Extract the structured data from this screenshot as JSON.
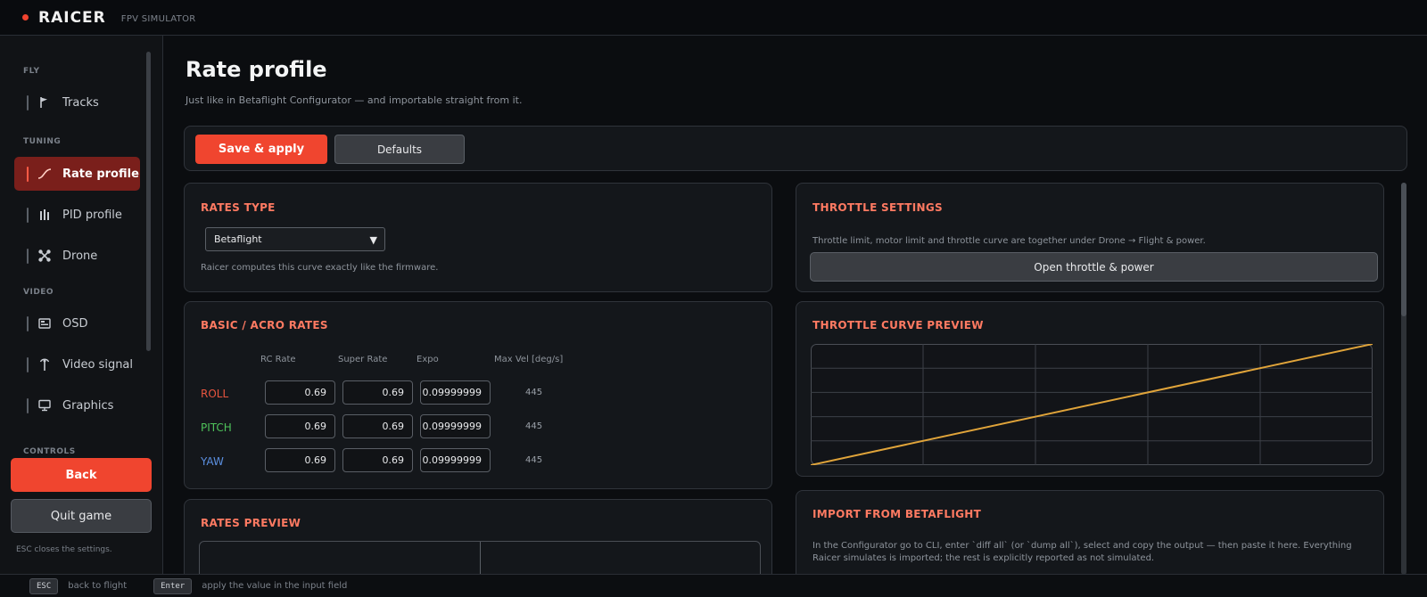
{
  "app": {
    "brand": "RAICER",
    "subtitle": "FPV SIMULATOR"
  },
  "sidebar": {
    "sections": [
      {
        "label": "FLY"
      },
      {
        "label": "TUNING"
      },
      {
        "label": "VIDEO"
      },
      {
        "label": "CONTROLS"
      }
    ],
    "items": [
      {
        "label": "Tracks",
        "icon": "flag-icon"
      },
      {
        "label": "Rate profile",
        "icon": "curve-icon",
        "active": true
      },
      {
        "label": "PID profile",
        "icon": "bars-icon"
      },
      {
        "label": "Drone",
        "icon": "drone-icon"
      },
      {
        "label": "OSD",
        "icon": "osd-icon"
      },
      {
        "label": "Video signal",
        "icon": "antenna-icon"
      },
      {
        "label": "Graphics",
        "icon": "monitor-icon"
      }
    ],
    "back_label": "Back",
    "quit_label": "Quit game",
    "esc_hint": "ESC closes the settings."
  },
  "bottom": {
    "hints": [
      {
        "key": "ESC",
        "text": "back to flight"
      },
      {
        "key": "Enter",
        "text": "apply the value in the input field"
      }
    ]
  },
  "page": {
    "title": "Rate profile",
    "subtitle": "Just like in Betaflight Configurator — and importable straight from it.",
    "save_label": "Save & apply",
    "defaults_label": "Defaults"
  },
  "rates_type": {
    "title": "RATES TYPE",
    "selected": "Betaflight",
    "note": "Raicer computes this curve exactly like the firmware."
  },
  "acro": {
    "title": "BASIC / ACRO RATES",
    "columns": [
      "RC Rate",
      "Super Rate",
      "Expo",
      "Max Vel [deg/s]"
    ],
    "rows": [
      {
        "label": "ROLL",
        "rc_rate": "0.69",
        "super_rate": "0.69",
        "expo": "0.09999999",
        "max_vel": "445",
        "color": "#e8553f"
      },
      {
        "label": "PITCH",
        "rc_rate": "0.69",
        "super_rate": "0.69",
        "expo": "0.09999999",
        "max_vel": "445",
        "color": "#4ec25a"
      },
      {
        "label": "YAW",
        "rc_rate": "0.69",
        "super_rate": "0.69",
        "expo": "0.09999999",
        "max_vel": "445",
        "color": "#5b8fe0"
      }
    ]
  },
  "rates_preview": {
    "title": "RATES PREVIEW"
  },
  "throttle": {
    "title": "THROTTLE SETTINGS",
    "note": "Throttle limit, motor limit and throttle curve are together under Drone → Flight & power.",
    "open_label": "Open throttle & power"
  },
  "throttle_curve": {
    "title": "THROTTLE CURVE PREVIEW",
    "line_color": "#e0a43a",
    "points": [
      [
        0,
        0
      ],
      [
        1,
        1
      ]
    ]
  },
  "import": {
    "title": "IMPORT FROM BETAFLIGHT",
    "text": "In the Configurator go to CLI, enter `diff all` (or `dump all`), select and copy the output — then paste it here. Everything Raicer simulates is imported; the rest is explicitly reported as not simulated."
  },
  "colors": {
    "accent": "#f0452f",
    "panel_title": "#ff7a62"
  }
}
